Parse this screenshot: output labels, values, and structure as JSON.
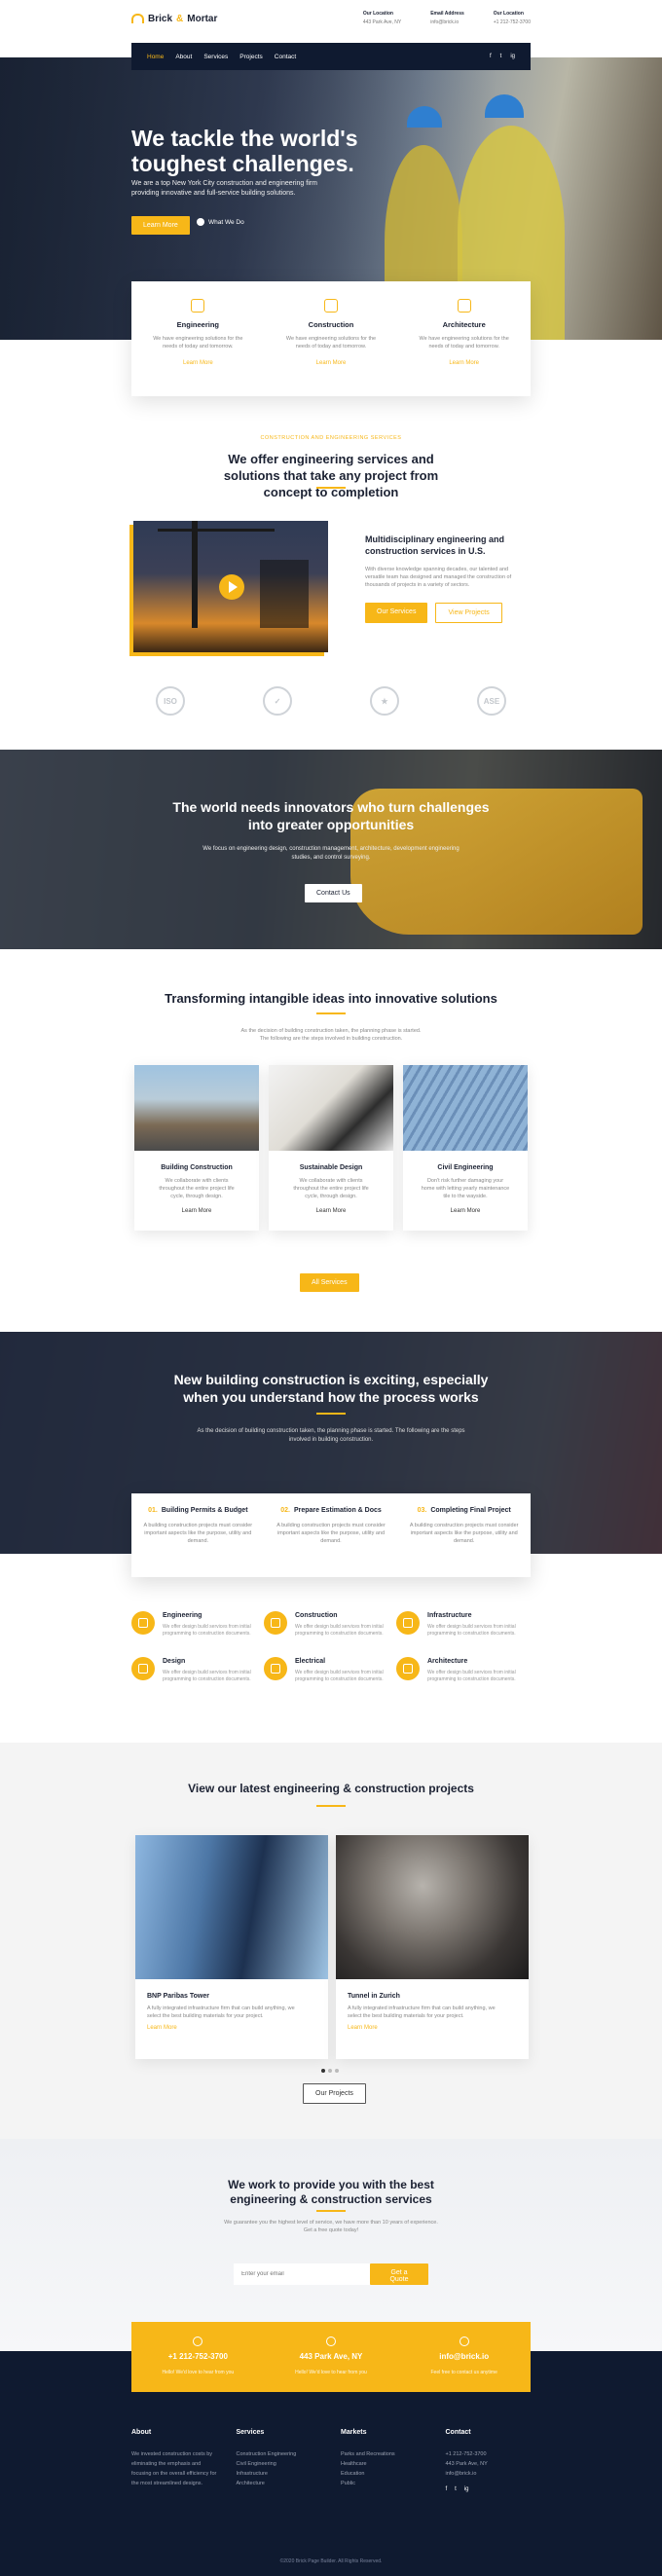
{
  "site": {
    "logo_a": "Brick",
    "logo_amp": "&",
    "logo_b": "Mortar"
  },
  "topinfo": [
    {
      "label": "Our Location",
      "value": "443 Park Ave, NY"
    },
    {
      "label": "Email Address",
      "value": "info@brick.io"
    },
    {
      "label": "Our Location",
      "value": "+1 212-752-3700"
    }
  ],
  "nav": [
    "Home",
    "About",
    "Services",
    "Projects",
    "Contact"
  ],
  "social": [
    "f",
    "t",
    "ig"
  ],
  "hero": {
    "title": "We tackle the world's toughest challenges.",
    "lead": "We are a top New York City construction and engineering firm providing innovative and full-service building solutions.",
    "btn1": "Learn More",
    "btn2": "What We Do"
  },
  "services": [
    {
      "title": "Engineering",
      "text": "We have engineering solutions for the needs of today and tomorrow.",
      "link": "Learn More"
    },
    {
      "title": "Construction",
      "text": "We have engineering solutions for the needs of today and tomorrow.",
      "link": "Learn More"
    },
    {
      "title": "Architecture",
      "text": "We have engineering solutions for the needs of today and tomorrow.",
      "link": "Learn More"
    }
  ],
  "intro": {
    "kicker": "CONSTRUCTION AND ENGINEERING SERVICES",
    "title": "We offer engineering services and solutions that take any project from concept to completion",
    "feat_title": "Multidisciplinary engineering and construction services in U.S.",
    "feat_text": "With diverse knowledge spanning decades, our talented and versatile team has designed and managed the construction of thousands of projects in a variety of sectors.",
    "btn1": "Our Services",
    "btn2": "View Projects"
  },
  "certs": [
    "ISO",
    "✓",
    "★",
    "ASE"
  ],
  "banner": {
    "title": "The world needs innovators who turn challenges into greater opportunities",
    "text": "We focus on engineering design, construction management, architecture, development engineering studies, and control surveying.",
    "btn": "Contact Us"
  },
  "solutions": {
    "title": "Transforming intangible ideas into innovative solutions",
    "sub": "As the decision of building construction taken, the planning phase is started. The following are the steps involved in building construction.",
    "items": [
      {
        "title": "Building Construction",
        "text": "We collaborate with clients throughout the entire project life cycle, through design.",
        "link": "Learn More"
      },
      {
        "title": "Sustainable Design",
        "text": "We collaborate with clients throughout the entire project life cycle, through design.",
        "link": "Learn More"
      },
      {
        "title": "Civil Engineering",
        "text": "Don't risk further damaging your home with letting yearly maintenance tile to the wayside.",
        "link": "Learn More"
      }
    ],
    "btn": "All Services"
  },
  "process": {
    "title": "New building construction is exciting, especially when you understand how the process works",
    "text": "As the decision of building construction taken, the planning phase is started. The following are the steps involved in building construction.",
    "steps": [
      {
        "num": "01.",
        "title": "Building Permits & Budget",
        "text": "A building construction projects must consider important aspects like the purpose, utility and demand."
      },
      {
        "num": "02.",
        "title": "Prepare Estimation & Docs",
        "text": "A building construction projects must consider important aspects like the purpose, utility and demand."
      },
      {
        "num": "03.",
        "title": "Completing Final Project",
        "text": "A building construction projects must consider important aspects like the purpose, utility and demand."
      }
    ]
  },
  "features": [
    {
      "title": "Engineering",
      "text": "We offer design build services from initial programming to construction documents."
    },
    {
      "title": "Construction",
      "text": "We offer design build services from initial programming to construction documents."
    },
    {
      "title": "Infrastructure",
      "text": "We offer design build services from initial programming to construction documents."
    },
    {
      "title": "Design",
      "text": "We offer design build services from initial programming to construction documents."
    },
    {
      "title": "Electrical",
      "text": "We offer design build services from initial programming to construction documents."
    },
    {
      "title": "Architecture",
      "text": "We offer design build services from initial programming to construction documents."
    }
  ],
  "projects": {
    "title": "View our latest engineering & construction projects",
    "items": [
      {
        "title": "BNP Paribas Tower",
        "text": "A fully integrated infrastructure firm that can build anything, we select the best building materials for your project.",
        "link": "Learn More"
      },
      {
        "title": "Tunnel in Zurich",
        "text": "A fully integrated infrastructure firm that can build anything, we select the best building materials for your project.",
        "link": "Learn More"
      }
    ],
    "btn": "Our Projects"
  },
  "cta": {
    "title": "We work to provide you with the best engineering & construction services",
    "note": "We guarantee you the highest level of service, we have more than 10 years of experience. Get a free quote today!",
    "placeholder": "Enter your email",
    "btn": "Get a Quote"
  },
  "strip": [
    {
      "value": "+1 212-752-3700",
      "sub": "Hello! We'd love to hear from you"
    },
    {
      "value": "443 Park Ave, NY",
      "sub": "Hello! We'd love to hear from you"
    },
    {
      "value": "info@brick.io",
      "sub": "Feel free to contact us anytime"
    }
  ],
  "footer": {
    "about_title": "About",
    "about_text": "We invested construction costs by eliminating the emphasis and focusing on the overall efficiency for the most streamlined designs.",
    "services_title": "Services",
    "services": [
      "Construction Engineering",
      "Civil Engineering",
      "Infrastructure",
      "Architecture"
    ],
    "markets_title": "Markets",
    "markets": [
      "Parks and Recreations",
      "Healthcare",
      "Education",
      "Public"
    ],
    "contact_title": "Contact",
    "contact": [
      "+1 212-752-3700",
      "443 Park Ave, NY",
      "info@brick.io"
    ],
    "copyright": "©2020 Brick Page Builder. All Rights Reserved."
  },
  "colors": {
    "accent": "#f7b718",
    "navy": "#0f1a30"
  }
}
